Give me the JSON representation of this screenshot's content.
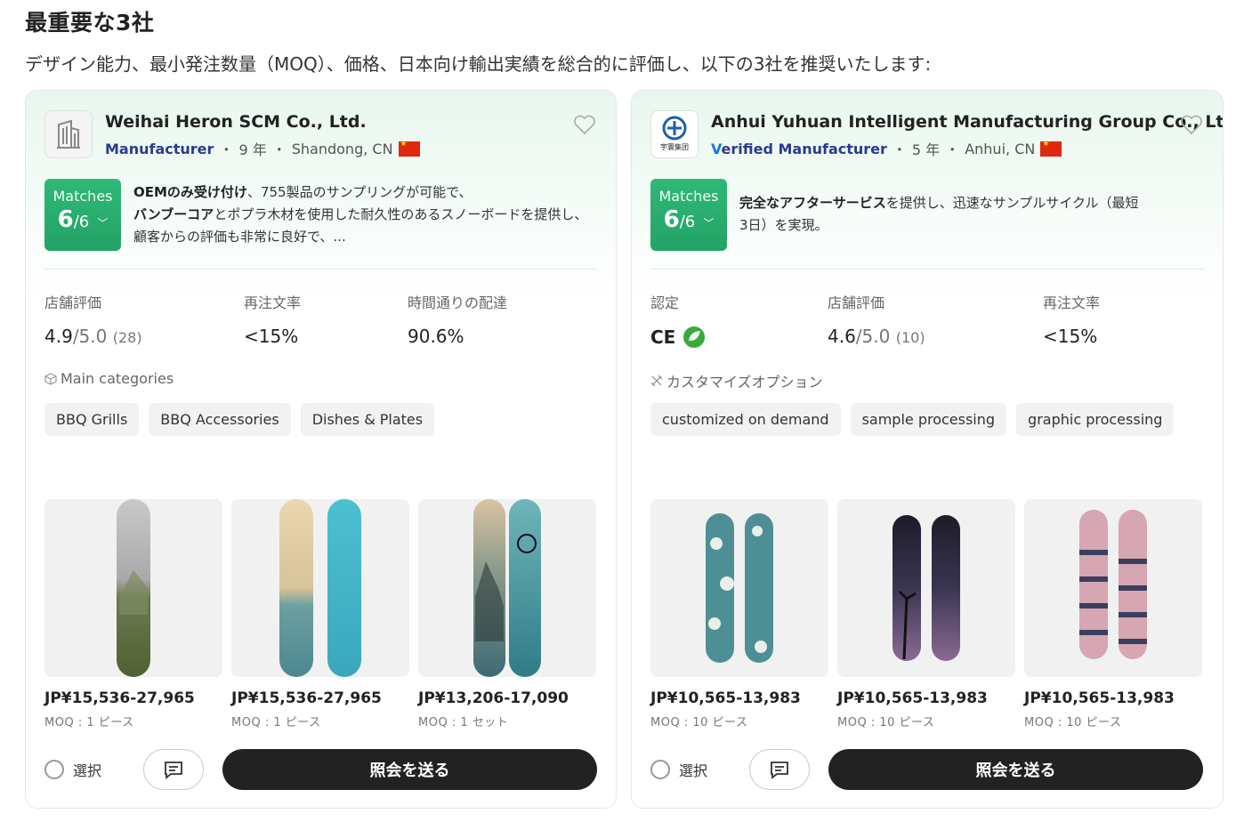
{
  "section_title": "最重要な3社",
  "intro_text": "デザイン能力、最小発注数量（MOQ）、価格、日本向け輸出実績を総合的に評価し、以下の3社を推奨いたします:",
  "colors": {
    "match_green": "#2fb877",
    "badge_blue": "#2b3a8f",
    "button_dark": "#222222"
  },
  "suppliers": [
    {
      "name": "Weihai Heron SCM Co., Ltd.",
      "logo_icon": "building-icon",
      "badge": "Manufacturer",
      "years": "9 年",
      "location": "Shandong, CN",
      "matches_label": "Matches",
      "matches_score": "6",
      "matches_total": "/6",
      "description": {
        "bold1": "OEMのみ受け付け",
        "text1": "、755製品のサンプリングが可能で、",
        "bold2": "バンブーコア",
        "text2": "とポプラ木材を使用した耐久性のあるスノーボードを提供し、顧客からの評価も非常に良好で、..."
      },
      "stats": [
        {
          "label": "店舗評価",
          "value": "4.9",
          "of": "/5.0",
          "count": "(28)"
        },
        {
          "label": "再注文率",
          "value": "<15%"
        },
        {
          "label": "時間通りの配達",
          "value": "90.6%"
        }
      ],
      "section_label": "Main categories",
      "chips": [
        "BBQ Grills",
        "BBQ Accessories",
        "Dishes & Plates"
      ],
      "products": [
        {
          "price": "JP¥15,536-27,965",
          "moq": "MOQ : 1 ピース"
        },
        {
          "price": "JP¥15,536-27,965",
          "moq": "MOQ : 1 ピース"
        },
        {
          "price": "JP¥13,206-17,090",
          "moq": "MOQ : 1 セット"
        }
      ],
      "select_label": "選択",
      "inquiry_label": "照会を送る"
    },
    {
      "name": "Anhui Yuhuan Intelligent Manufacturing Group Co., Ltd.",
      "logo_icon": "yuhuan-logo-icon",
      "badge_prefix": "V",
      "badge": "erified Manufacturer",
      "years": "5 年",
      "location": "Anhui, CN",
      "matches_label": "Matches",
      "matches_score": "6",
      "matches_total": "/6",
      "description": {
        "bold1": "完全なアフターサービス",
        "text1": "を提供し、迅速なサンプルサイクル（最短3日）を実現。"
      },
      "stats": [
        {
          "label": "認定",
          "value": "CE"
        },
        {
          "label": "店舗評価",
          "value": "4.6",
          "of": "/5.0",
          "count": "(10)"
        },
        {
          "label": "再注文率",
          "value": "<15%"
        }
      ],
      "section_label": "カスタマイズオプション",
      "chips": [
        "customized on demand",
        "sample processing",
        "graphic processing"
      ],
      "products": [
        {
          "price": "JP¥10,565-13,983",
          "moq": "MOQ : 10 ピース"
        },
        {
          "price": "JP¥10,565-13,983",
          "moq": "MOQ : 10 ピース"
        },
        {
          "price": "JP¥10,565-13,983",
          "moq": "MOQ : 10 ピース"
        }
      ],
      "select_label": "選択",
      "inquiry_label": "照会を送る"
    }
  ]
}
